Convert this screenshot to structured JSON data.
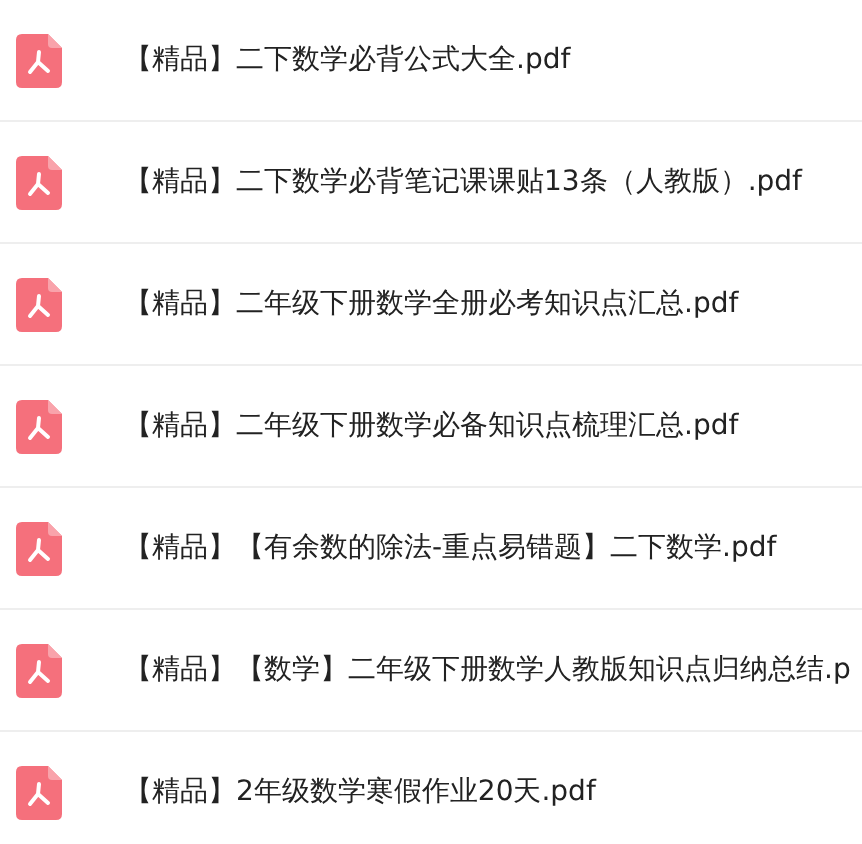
{
  "files": [
    {
      "name": "【精品】二下数学必背公式大全.pdf"
    },
    {
      "name": "【精品】二下数学必背笔记课课贴13条（人教版）.pdf"
    },
    {
      "name": "【精品】二年级下册数学全册必考知识点汇总.pdf"
    },
    {
      "name": "【精品】二年级下册数学必备知识点梳理汇总.pdf"
    },
    {
      "name": "【精品】【有余数的除法-重点易错题】二下数学.pdf"
    },
    {
      "name": "【精品】【数学】二年级下册数学人教版知识点归纳总结.p"
    },
    {
      "name": "【精品】2年级数学寒假作业20天.pdf"
    }
  ]
}
